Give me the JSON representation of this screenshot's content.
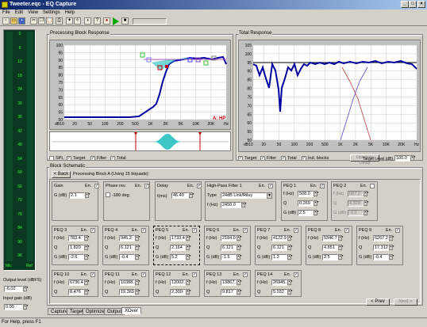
{
  "window": {
    "title": "Tweeter.eqc - EQ Capture"
  },
  "menu": [
    "File",
    "Edit",
    "View",
    "Settings",
    "Help"
  ],
  "meter": {
    "scale": [
      "0",
      "6",
      "12",
      "18",
      "24",
      "30",
      "36",
      "42",
      "48",
      "54",
      "60",
      "66",
      "72",
      "78",
      "84",
      "90",
      "96"
    ],
    "left_label": "Mic",
    "right_label": "Ref"
  },
  "output_level": {
    "label": "Output level (dBFS)",
    "value": "-6.02"
  },
  "input_gain": {
    "label": "Input gain (dB)",
    "value": "0.00"
  },
  "proc_block": {
    "title": "Processing Block Response",
    "y_ticks": [
      "100",
      "95",
      "90",
      "85",
      "80",
      "75",
      "70",
      "65",
      "60",
      "55",
      "50"
    ],
    "x_ticks": [
      "dB10",
      "20",
      "50",
      "100",
      "200",
      "500",
      "1K",
      "2K",
      "5K",
      "10K",
      "20K",
      "Hz"
    ],
    "marker": "A: HP",
    "checks": [
      {
        "label": "SPL",
        "checked": false
      },
      {
        "label": "Target",
        "checked": true
      },
      {
        "label": "Filter",
        "checked": true
      },
      {
        "label": "Total",
        "checked": true
      }
    ]
  },
  "total": {
    "title": "Total Response",
    "y_ticks": [
      "105",
      "100",
      "95",
      "90",
      "85",
      "80",
      "75",
      "70",
      "65",
      "60",
      "55",
      "50"
    ],
    "x_ticks": [
      "dB10",
      "20",
      "50",
      "100",
      "200",
      "500",
      "1K",
      "2K",
      "5K",
      "10K",
      "20K",
      "Hz"
    ],
    "checks": [
      {
        "label": "Target",
        "checked": true
      },
      {
        "label": "Filter",
        "checked": true
      },
      {
        "label": "Total",
        "checked": true
      },
      {
        "label": "Ind. blocks",
        "checked": true
      }
    ],
    "optimize_label": "Optimize Delay",
    "target_level_label": "Target Level (dB)",
    "target_level": "100.0"
  },
  "schematic": {
    "title": "Block Schematic",
    "back": "< Back",
    "info": "Processing Block A (Using 15 biquads):"
  },
  "blocks": {
    "gain": {
      "title": "Gain",
      "en": "En.",
      "checked": true,
      "label": "G (dB)",
      "value": "2.1"
    },
    "phase": {
      "title": "Phase rev.",
      "en": "En.",
      "checked": true,
      "option": "-180 deg."
    },
    "delay": {
      "title": "Delay",
      "en": "En.",
      "checked": true,
      "label": "t(ms)",
      "value": "46.49"
    },
    "hp": {
      "title": "High-Pass Filter 1",
      "en": "En.",
      "checked": true,
      "type_label": "Type",
      "type": "24dB Link/Riley",
      "f_label": "f (Hz)",
      "f": "2450.0"
    },
    "peq1": {
      "title": "PEQ 1",
      "en": "En.",
      "checked": true,
      "f": "508.0",
      "q": "0.269",
      "g": "2.5"
    },
    "peq2": {
      "title": "PEQ 2",
      "en": "En.",
      "checked": false,
      "f": "687.0",
      "q": "4.328",
      "g": "-0.3"
    },
    "row2": [
      {
        "title": "PEQ 3",
        "f": "783.4",
        "q": "1.820",
        "g": "-2.6"
      },
      {
        "title": "PEQ 4",
        "f": "945.2",
        "q": "6.121",
        "g": "-0.4"
      },
      {
        "title": "PEQ 5",
        "f": "1733.4",
        "q": "2.164",
        "g": "5.2"
      },
      {
        "title": "PEQ 6",
        "f": "2184.0",
        "q": "6.121",
        "g": "-1.5"
      },
      {
        "title": "PEQ 7",
        "f": "4122.9",
        "q": "6.121",
        "g": "1.3"
      },
      {
        "title": "PEQ 8",
        "f": "5346.7",
        "q": "4.851",
        "g": "2.5"
      },
      {
        "title": "PEQ 9",
        "f": "6267.2",
        "q": "17.312",
        "g": "-0.4"
      }
    ],
    "row3": [
      {
        "title": "PEQ 10",
        "f": "6736.4",
        "q": "8.476"
      },
      {
        "title": "PEQ 11",
        "f": "10388.9",
        "q": "19.369"
      },
      {
        "title": "PEQ 12",
        "f": "12002.9",
        "q": "2.300"
      },
      {
        "title": "PEQ 13",
        "f": "13867.6",
        "q": "9.817"
      },
      {
        "title": "PEQ 14",
        "f": "26945.6",
        "q": "5.032"
      }
    ],
    "labels": {
      "f": "f (Hz)",
      "q": "Q",
      "g": "G (dB)",
      "en": "En."
    }
  },
  "nav": {
    "prev": "< Prev",
    "next": "Next >"
  },
  "tabs": [
    "Capture",
    "Target",
    "Optimizer",
    "Output",
    "XOver"
  ],
  "status": "For Help, press F1"
}
